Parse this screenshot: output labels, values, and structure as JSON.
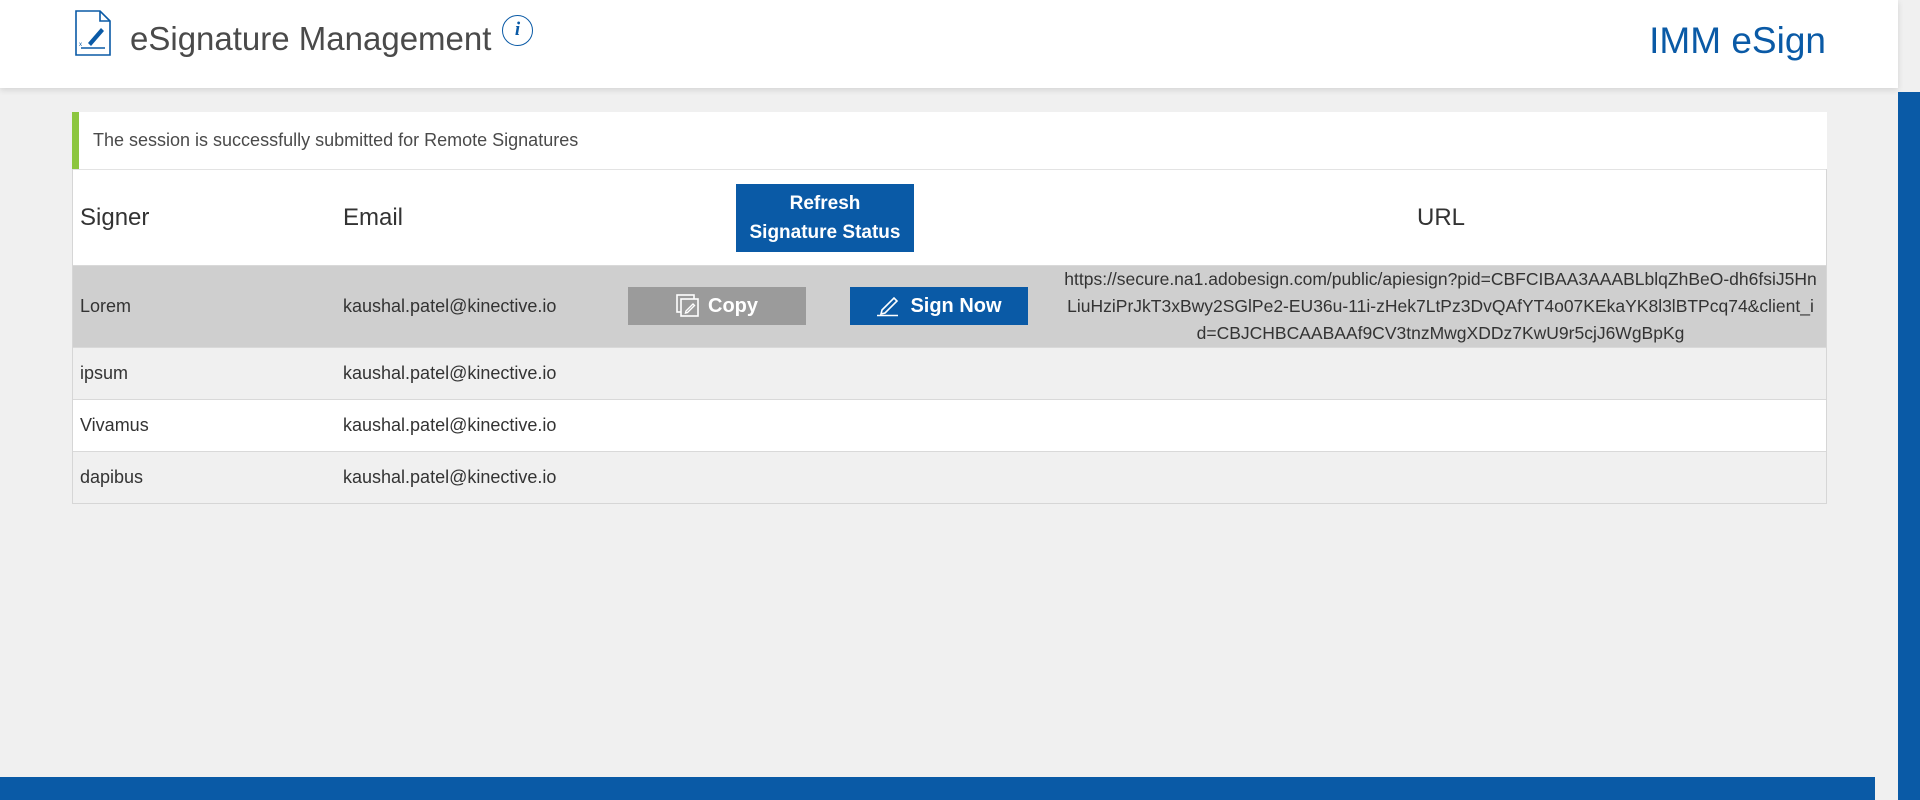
{
  "header": {
    "title": "eSignature Management",
    "brand": "IMM eSign",
    "info_icon": "info-icon",
    "doc_icon": "document-signature-icon"
  },
  "alert": {
    "message": "The session is successfully submitted for Remote Signatures",
    "accent_color": "#8cc63f"
  },
  "table": {
    "headers": {
      "signer": "Signer",
      "email": "Email",
      "refresh_line1": "Refresh",
      "refresh_line2": "Signature Status",
      "url": "URL"
    },
    "rows": [
      {
        "signer": "Lorem",
        "email": "kaushal.patel@kinective.io",
        "copy_label": "Copy",
        "sign_label": "Sign Now",
        "url": "https://secure.na1.adobesign.com/public/apiesign?pid=CBFCIBAA3AAABLblqZhBeO-dh6fsiJ5HnLiuHziPrJkT3xBwy2SGlPe2-EU36u-11i-zHek7LtPz3DvQAfYT4o07KEkaYK8l3lBTPcq74&client_id=CBJCHBCAABAAf9CV3tnzMwgXDDz7KwU9r5cjJ6WgBpKg"
      },
      {
        "signer": "ipsum",
        "email": "kaushal.patel@kinective.io"
      },
      {
        "signer": "Vivamus",
        "email": "kaushal.patel@kinective.io"
      },
      {
        "signer": "dapibus",
        "email": "kaushal.patel@kinective.io"
      }
    ]
  },
  "colors": {
    "primary": "#0a5aa6",
    "copy_button": "#9b9b9b",
    "active_row": "#cfcfcf",
    "background": "#f0f0f0"
  },
  "icons": {
    "copy": "copy-icon",
    "sign": "pen-icon"
  }
}
